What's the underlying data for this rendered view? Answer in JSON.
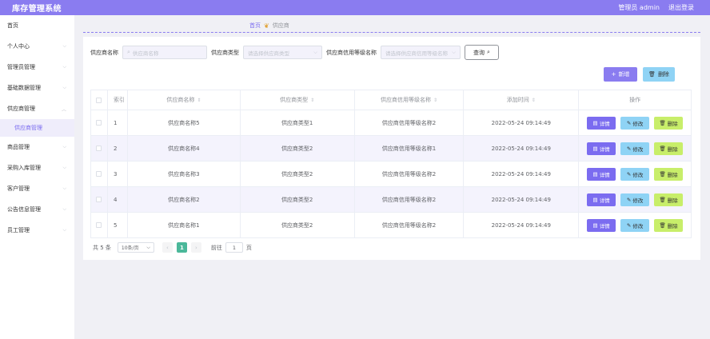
{
  "header": {
    "title": "库存管理系统",
    "admin_label": "管理员 admin",
    "logout_label": "退出登录"
  },
  "sidebar": {
    "items": [
      {
        "label": "首页",
        "has_arrow": false
      },
      {
        "label": "个人中心",
        "has_arrow": true
      },
      {
        "label": "管理员管理",
        "has_arrow": true
      },
      {
        "label": "基础数据管理",
        "has_arrow": true
      },
      {
        "label": "供应商管理",
        "has_arrow": true
      }
    ],
    "active_sub": "供应商管理",
    "items_after": [
      {
        "label": "商品管理",
        "has_arrow": true
      },
      {
        "label": "采购入库管理",
        "has_arrow": true
      },
      {
        "label": "客户管理",
        "has_arrow": true
      },
      {
        "label": "公告信息管理",
        "has_arrow": true
      },
      {
        "label": "员工管理",
        "has_arrow": true
      }
    ]
  },
  "breadcrumb": {
    "home": "首页",
    "current": "供应商"
  },
  "search": {
    "name_label": "供应商名称",
    "name_placeholder": "供应商名称",
    "type_label": "供应商类型",
    "type_placeholder": "请选择供应商类型",
    "level_label": "供应商信用等级名称",
    "level_placeholder": "请选择供应商信用等级名称",
    "query_label": "查询"
  },
  "actions": {
    "add_label": "新增",
    "delete_label": "删除"
  },
  "table": {
    "columns": [
      "索引",
      "供应商名称",
      "供应商类型",
      "供应商信用等级名称",
      "添加时间",
      "操作"
    ],
    "rows": [
      {
        "index": "1",
        "name": "供应商名称5",
        "type": "供应商类型1",
        "level": "供应商信用等级名称2",
        "time": "2022-05-24 09:14:49"
      },
      {
        "index": "2",
        "name": "供应商名称4",
        "type": "供应商类型2",
        "level": "供应商信用等级名称1",
        "time": "2022-05-24 09:14:49"
      },
      {
        "index": "3",
        "name": "供应商名称3",
        "type": "供应商类型2",
        "level": "供应商信用等级名称2",
        "time": "2022-05-24 09:14:49"
      },
      {
        "index": "4",
        "name": "供应商名称2",
        "type": "供应商类型2",
        "level": "供应商信用等级名称2",
        "time": "2022-05-24 09:14:49"
      },
      {
        "index": "5",
        "name": "供应商名称1",
        "type": "供应商类型2",
        "level": "供应商信用等级名称2",
        "time": "2022-05-24 09:14:49"
      }
    ],
    "row_actions": {
      "detail": "详情",
      "edit": "修改",
      "delete": "删除"
    }
  },
  "pager": {
    "total": "共 5 条",
    "page_size": "10条/页",
    "current": "1",
    "goto_label": "前往",
    "goto_value": "1",
    "page_suffix": "页"
  },
  "colors": {
    "primary": "#8a7cf0",
    "edit": "#8fd3f5",
    "delete": "#c8ee6a",
    "pager_active": "#4bb89a"
  },
  "icons": {
    "search": "search-icon",
    "chevron": "chevron-down-icon",
    "add": "plus-icon",
    "delete": "trash-icon",
    "detail": "document-icon",
    "edit": "pencil-icon",
    "sort": "sort-icon"
  }
}
